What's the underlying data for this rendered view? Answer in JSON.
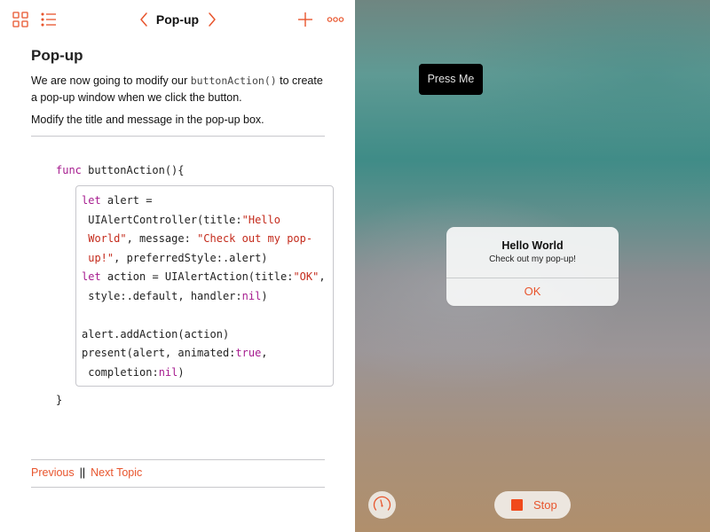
{
  "toolbar": {
    "title": "Pop-up",
    "icons": [
      "grid-icon",
      "list-icon",
      "chevron-left-icon",
      "chevron-right-icon",
      "plus-icon",
      "more-icon"
    ]
  },
  "lesson": {
    "heading": "Pop-up",
    "para1_before": "We are now going to modify our ",
    "para1_code": "buttonAction()",
    "para1_after": " to create a pop-up window when we click the button.",
    "para2": "Modify the title and message in the pop-up box."
  },
  "code": {
    "func_keyword": "func",
    "func_signature": " buttonAction(){",
    "closing_brace": "}",
    "lines": [
      [
        {
          "t": "let",
          "k": "kw"
        },
        {
          "t": " alert ="
        }
      ],
      [
        {
          "t": " UIAlertController(title:"
        },
        {
          "t": "\"Hello",
          "k": "str"
        }
      ],
      [
        {
          "t": " World\"",
          "k": "str"
        },
        {
          "t": ", message: "
        },
        {
          "t": "\"Check out my pop-",
          "k": "str"
        }
      ],
      [
        {
          "t": " up!\"",
          "k": "str"
        },
        {
          "t": ", preferredStyle:.alert)"
        }
      ],
      [
        {
          "t": "let",
          "k": "kw"
        },
        {
          "t": " action = UIAlertAction(title:"
        },
        {
          "t": "\"OK\"",
          "k": "str"
        },
        {
          "t": ","
        }
      ],
      [
        {
          "t": " style:.default, handler:"
        },
        {
          "t": "nil",
          "k": "kw"
        },
        {
          "t": ")"
        }
      ],
      [
        {
          "t": ""
        }
      ],
      [
        {
          "t": "alert.addAction(action)"
        }
      ],
      [
        {
          "t": "present(alert, animated:"
        },
        {
          "t": "true",
          "k": "kw"
        },
        {
          "t": ","
        }
      ],
      [
        {
          "t": " completion:"
        },
        {
          "t": "nil",
          "k": "kw"
        },
        {
          "t": ")"
        }
      ]
    ]
  },
  "footer_nav": {
    "previous": "Previous",
    "separator": "||",
    "next": "Next Topic"
  },
  "preview": {
    "button_label": "Press Me",
    "alert": {
      "title": "Hello World",
      "message": "Check out my pop-up!",
      "ok_label": "OK"
    },
    "stop_label": "Stop"
  },
  "colors": {
    "accent": "#e8552d",
    "keyword": "#a61d8f",
    "string": "#c42b1c"
  }
}
